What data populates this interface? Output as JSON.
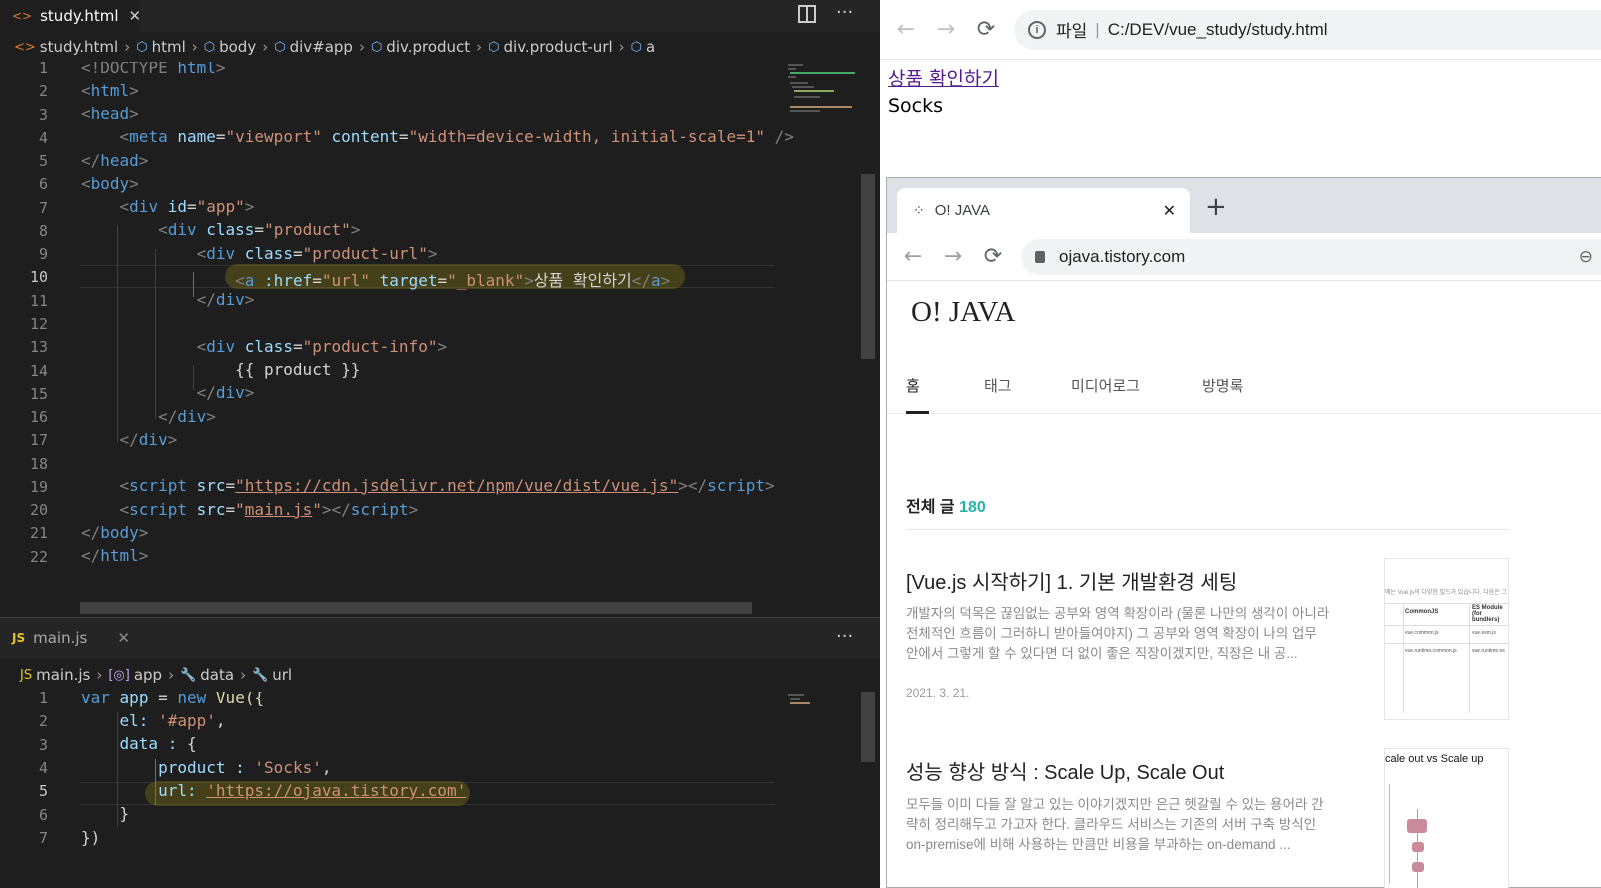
{
  "editor": {
    "tab1": {
      "icon": "<>",
      "name": "study.html",
      "close": "✕"
    },
    "breadcrumb1": [
      "study.html",
      "html",
      "body",
      "div#app",
      "div.product",
      "div.product-url",
      "a"
    ],
    "html_lines": [
      "1",
      "2",
      "3",
      "4",
      "5",
      "6",
      "7",
      "8",
      "9",
      "10",
      "11",
      "12",
      "13",
      "14",
      "15",
      "16",
      "17",
      "18",
      "19",
      "20",
      "21",
      "22"
    ],
    "tab2": {
      "icon": "JS",
      "name": "main.js",
      "close": "✕"
    },
    "breadcrumb2": [
      "main.js",
      "app",
      "data",
      "url"
    ],
    "js_lines": [
      "1",
      "2",
      "3",
      "4",
      "5",
      "6",
      "7"
    ],
    "more": "···",
    "code": {
      "l1a": "<!DOCTYPE",
      "l1b": "html",
      "l1c": ">",
      "l4_name": "\"viewport\"",
      "l4_content": "\"width=device-width, initial-scale=1\"",
      "l7_id": "\"app\"",
      "l8_cls": "\"product\"",
      "l9_cls": "\"product-url\"",
      "l10_href": "\"url\"",
      "l10_target": "\"_blank\"",
      "l10_text": "상품 확인하기",
      "l13_cls": "\"product-info\"",
      "l14": "{{ product }}",
      "l19_src": "\"https://cdn.jsdelivr.net/npm/vue/dist/vue.js\"",
      "l20_src": "main.js",
      "js1a": "var",
      "js1b": "app",
      "js1c": "=",
      "js1d": "new",
      "js1e": "Vue({",
      "js2a": "el:",
      "js2b": "'#app'",
      "js2c": ",",
      "js3a": "data :",
      "js3b": "{",
      "js4a": "product :",
      "js4b": "'Socks'",
      "js4c": ",",
      "js5a": "url:",
      "js5b": "'https://ojava.tistory.com'",
      "js6": "}",
      "js7": "})"
    }
  },
  "browser": {
    "back": "←",
    "forward": "→",
    "reload": "⟳",
    "url_label": "파일",
    "url_sep": "|",
    "url": "C:/DEV/vue_study/study.html",
    "link_text": "상품 확인하기",
    "product": "Socks"
  },
  "popup": {
    "tab_title": "O! JAVA",
    "tab_close": "✕",
    "new_tab": "+",
    "url": "ojava.tistory.com",
    "blog_title": "O! JAVA",
    "nav": [
      "홈",
      "태그",
      "미디어로그",
      "방명록"
    ],
    "total_label": "전체 글",
    "total_count": "180",
    "posts": [
      {
        "title": "[Vue.js 시작하기] 1. 기본 개발환경 세팅",
        "excerpt": "개발자의 덕목은 끊임없는 공부와 영역 확장이라 (물론 나만의 생각이 아니라 전체적인 흐름이 그러하니 받아들여야지) 그 공부와 영역 확장이 나의 업무 안에서 그렇게 할 수 있다면 더 없이 좋은 직장이겠지만, 직장은 내 공...",
        "date": "2021. 3. 21."
      },
      {
        "title": "성능 향상 방식 : Scale Up, Scale Out",
        "excerpt": "모두들 이미 다들 잘 알고 있는 이야기겠지만 은근 헷갈릴 수 있는 용어라 간략히 정리해두고 가고자 한다. 클라우드 서비스는 기존의 서버 구축 방식인 on-premise에 비해 사용하는 만큼만 비용을 부과하는 on-demand ...",
        "thumb_title": "cale out vs Scale up"
      }
    ],
    "thumb1": {
      "line": "에는 Vue.js의 다양한 빌드가 있습니다. 다음은 그",
      "h1": "CommonJS",
      "h2": "ES Module (for bundlers)",
      "r1a": "vue.common.js",
      "r1b": "vue.esm.js",
      "r2a": "vue.runtime.common.js",
      "r2b": "vue.runtime.es"
    }
  }
}
